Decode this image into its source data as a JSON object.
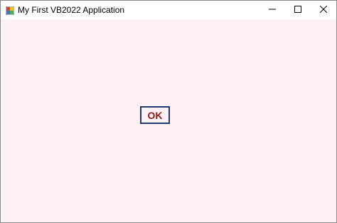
{
  "window": {
    "title": "My First VB2022 Application",
    "icon": "app-icon",
    "controls": {
      "minimize": "minimize-icon",
      "maximize": "maximize-icon",
      "close": "close-icon"
    }
  },
  "form": {
    "background_color": "#fff0f5",
    "ok_button": {
      "label": "OK",
      "text_color": "#8b1a1a",
      "border_color": "#1f3a6e"
    }
  }
}
